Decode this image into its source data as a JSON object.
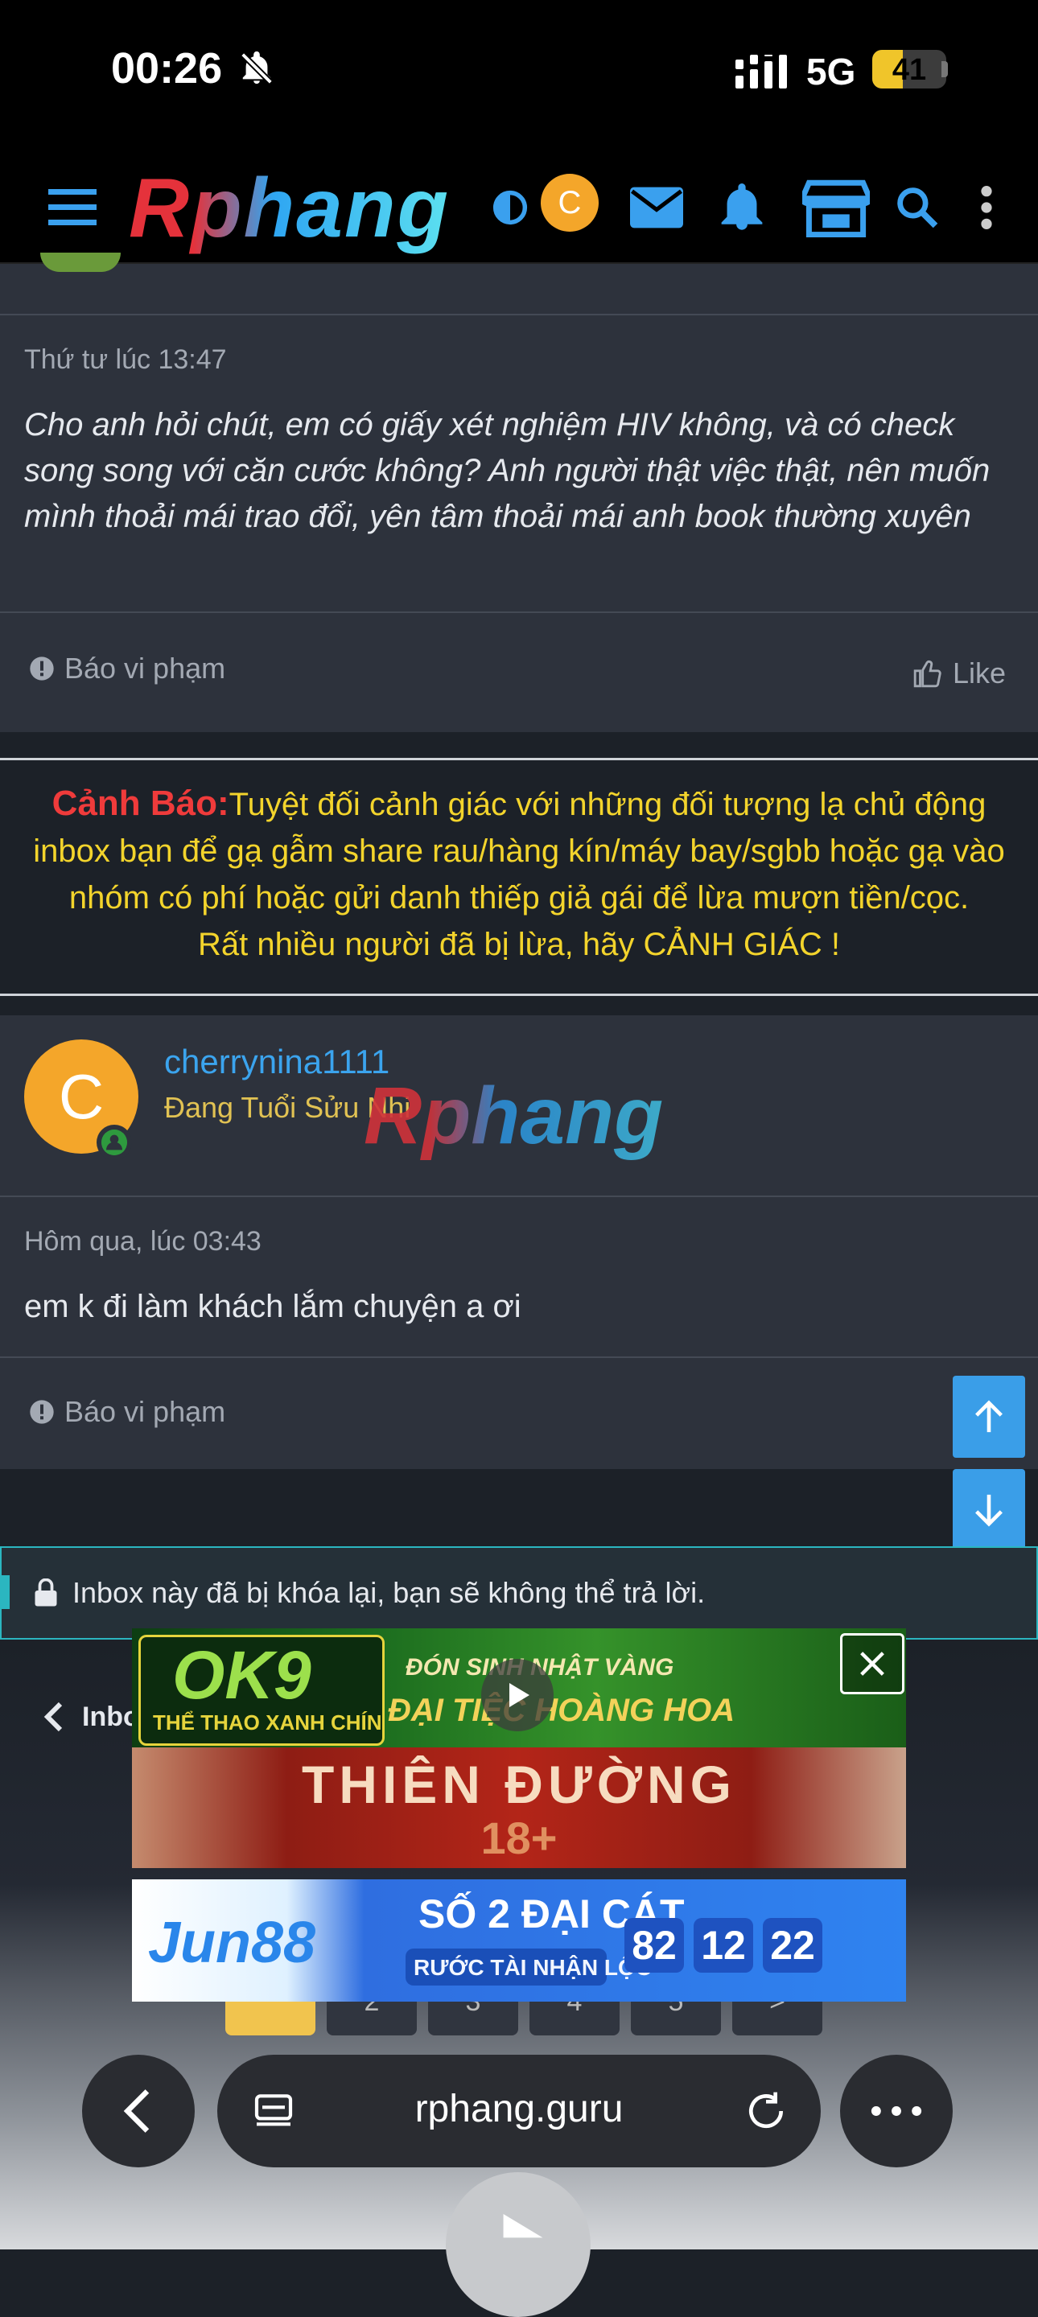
{
  "status_bar": {
    "time": "00:26",
    "network": "5G",
    "battery": "41",
    "battery_level_percent": 41
  },
  "header": {
    "logo": "Rphang",
    "avatar_letter": "C"
  },
  "post1": {
    "date": "Thứ tư lúc 13:47",
    "text": "Cho anh hỏi chút, em có giấy xét nghiệm HIV không, và có check song song với căn cước không? Anh người thật việc thật, nên muốn mình thoải mái trao đổi, yên tâm thoải mái anh book thường xuyên",
    "report_label": "Báo vi phạm",
    "like_label": "Like"
  },
  "warning": {
    "title": "Cảnh Báo:",
    "line1": "Tuyệt đối cảnh giác với những đối tượng lạ chủ động",
    "line2": "inbox bạn để gạ gẫm share rau/hàng kín/máy bay/sgbb hoặc gạ vào",
    "line3": "nhóm có phí hoặc gửi danh thiếp giả gái để lừa mượn tiền/cọc.",
    "line4": "Rất nhiều người đã bị lừa, hãy CẢNH GIÁC !"
  },
  "post2": {
    "avatar_letter": "C",
    "username": "cherrynina1111",
    "user_title": "Đang Tuổi Sửu Nhi",
    "watermark": "Rphang",
    "date": "Hôm qua, lúc 03:43",
    "text": "em k đi làm khách lắm chuyện a ơi",
    "report_label": "Báo vi phạm"
  },
  "locked_notice": "Inbox này đã bị khóa lại, bạn sẽ không thể trả lời.",
  "inbox_link": "Inbo",
  "pager": [
    "",
    "2",
    "3",
    "4",
    "5",
    ">"
  ],
  "ads": {
    "ad1": {
      "brand": "OK9",
      "tagline": "THỂ THAO XANH CHÍN",
      "promo_top": "ĐÓN SINH NHẬT VÀNG",
      "promo_bottom": "ĐẠI TIỆC HOÀNG HOA"
    },
    "ad2": {
      "title": "THIÊN ĐƯỜNG",
      "subtitle": "18+"
    },
    "ad3": {
      "brand": "Jun88",
      "title": "SỐ 2 ĐẠI CÁT",
      "subtitle": "RƯỚC TÀI NHẬN LỘC",
      "n1": "82",
      "n2": "12",
      "n3": "22"
    }
  },
  "browser": {
    "url": "rphang.guru"
  }
}
